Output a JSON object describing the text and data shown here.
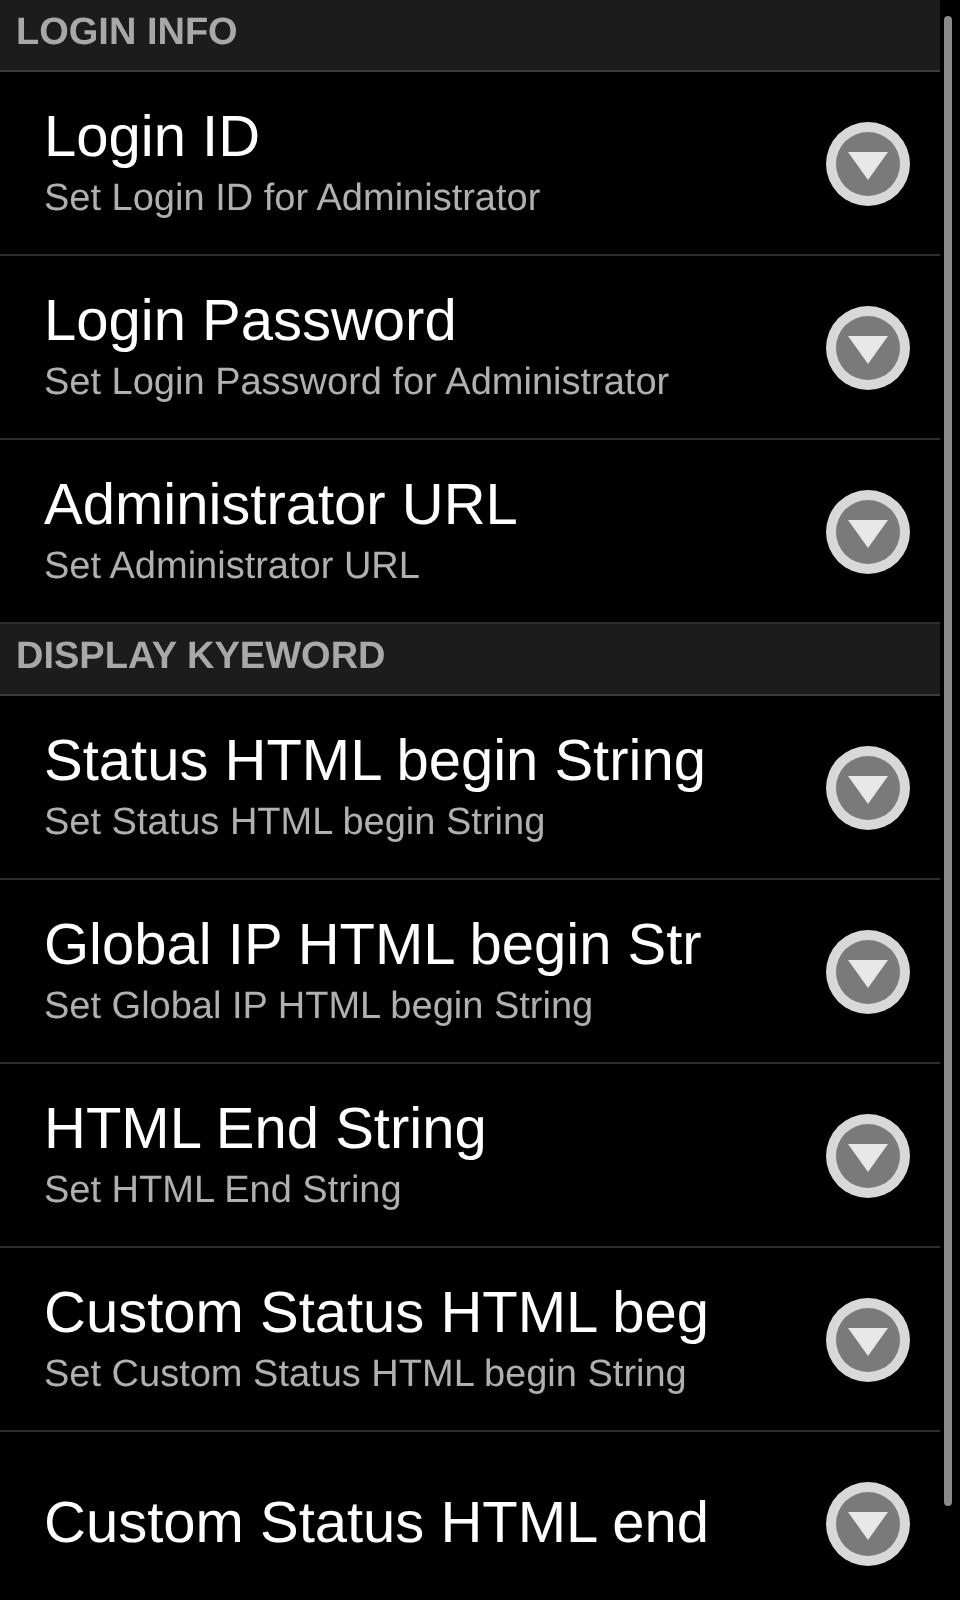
{
  "sections": [
    {
      "header": "LOGIN INFO",
      "items": [
        {
          "title": "Login ID",
          "summary": "Set Login ID for Administrator"
        },
        {
          "title": "Login Password",
          "summary": "Set Login Password for Administrator"
        },
        {
          "title": "Administrator URL",
          "summary": "Set Administrator URL"
        }
      ]
    },
    {
      "header": "DISPLAY KYEWORD",
      "items": [
        {
          "title": "Status HTML begin String",
          "summary": "Set Status HTML begin String"
        },
        {
          "title": "Global IP HTML begin Str",
          "summary": "Set Global IP HTML begin String"
        },
        {
          "title": "HTML End String",
          "summary": "Set HTML End String"
        },
        {
          "title": "Custom Status HTML beg",
          "summary": "Set Custom Status HTML begin String"
        },
        {
          "title": "Custom Status HTML end"
        }
      ]
    }
  ]
}
